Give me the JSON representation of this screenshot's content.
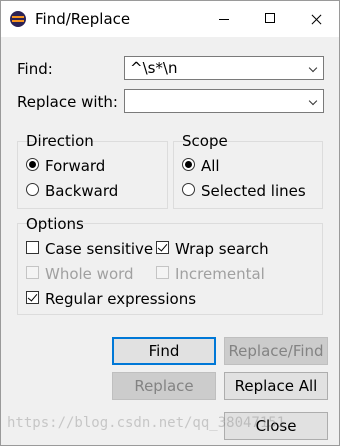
{
  "window": {
    "title": "Find/Replace",
    "icon": "eclipse-icon"
  },
  "find": {
    "label": "Find:",
    "value": "^\\s*\\n"
  },
  "replace": {
    "label": "Replace with:",
    "value": ""
  },
  "direction": {
    "label": "Direction",
    "options": [
      {
        "label": "Forward",
        "checked": true
      },
      {
        "label": "Backward",
        "checked": false
      }
    ]
  },
  "scope": {
    "label": "Scope",
    "options": [
      {
        "label": "All",
        "checked": true
      },
      {
        "label": "Selected lines",
        "checked": false
      }
    ]
  },
  "options": {
    "label": "Options",
    "case_sensitive": {
      "label": "Case sensitive",
      "checked": false,
      "enabled": true
    },
    "wrap_search": {
      "label": "Wrap search",
      "checked": true,
      "enabled": true
    },
    "whole_word": {
      "label": "Whole word",
      "checked": false,
      "enabled": false
    },
    "incremental": {
      "label": "Incremental",
      "checked": false,
      "enabled": false
    },
    "regular_expressions": {
      "label": "Regular expressions",
      "checked": true,
      "enabled": true
    }
  },
  "buttons": {
    "find": {
      "label": "Find",
      "enabled": true
    },
    "replace_find": {
      "label": "Replace/Find",
      "enabled": false
    },
    "replace": {
      "label": "Replace",
      "enabled": false
    },
    "replace_all": {
      "label": "Replace All",
      "enabled": true
    },
    "close": {
      "label": "Close",
      "enabled": true
    }
  },
  "watermark": "https://blog.csdn.net/qq_38047151",
  "colors": {
    "default_button_border": "#0078d7",
    "disabled_text": "#a0a0a0"
  }
}
